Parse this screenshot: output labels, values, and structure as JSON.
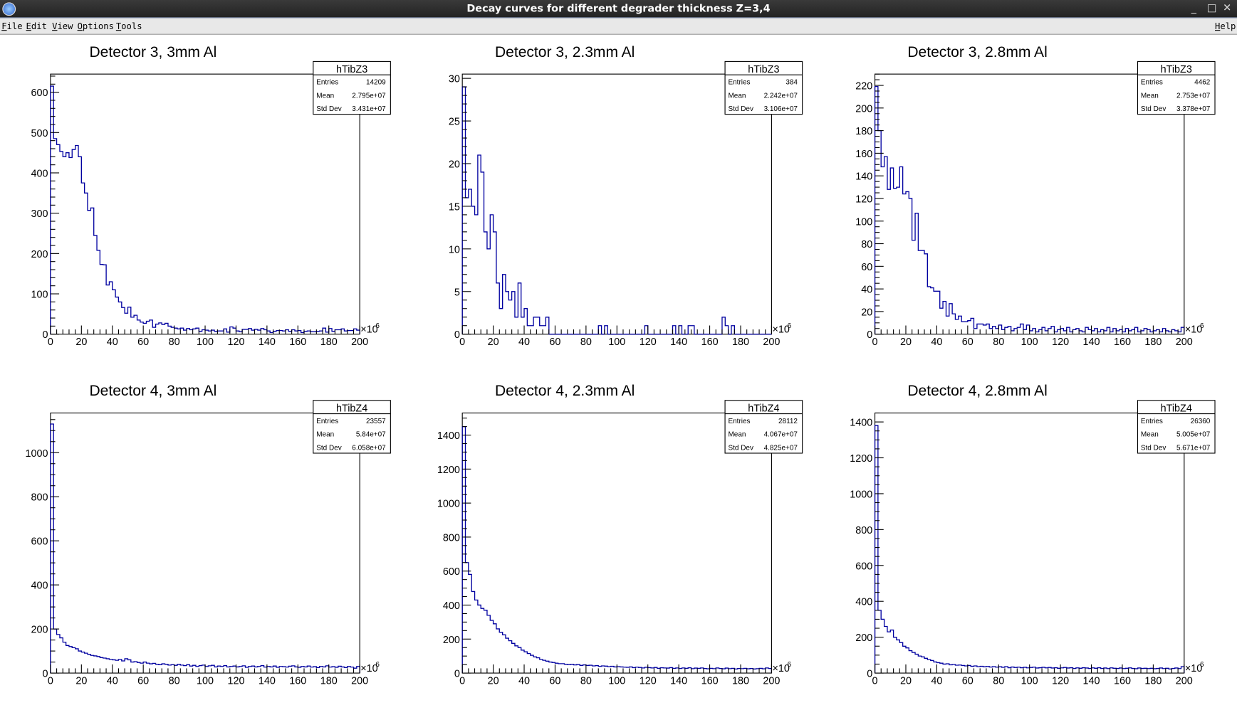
{
  "window": {
    "title": "Decay curves for different degrader thickness Z=3,4",
    "buttons": {
      "minimize": "_",
      "maximize": "□",
      "close": "✕"
    }
  },
  "menu": {
    "items": [
      "File",
      "Edit",
      "View",
      "Options",
      "Tools"
    ],
    "help": "Help"
  },
  "colors": {
    "line": "#0000a0",
    "frame": "#000000"
  },
  "chart_data": [
    {
      "type": "histogram",
      "title": "Detector 3, 3mm Al",
      "stats": {
        "name": "hTibZ3",
        "rows": [
          [
            "Entries",
            "14209"
          ],
          [
            "Mean",
            "2.795e+07"
          ],
          [
            "Std Dev",
            "3.431e+07"
          ]
        ]
      },
      "xlim": [
        0,
        200
      ],
      "x_multiplier": "×10",
      "x_exponent": "6",
      "xticks": [
        "0",
        "20",
        "40",
        "60",
        "80",
        "100",
        "120",
        "140",
        "160",
        "180",
        "200"
      ],
      "ylim": [
        0,
        645
      ],
      "yticks": [
        0,
        100,
        200,
        300,
        400,
        500,
        600
      ],
      "yminor": 20,
      "values": [
        615,
        485,
        470,
        453,
        440,
        450,
        438,
        458,
        468,
        440,
        375,
        350,
        307,
        313,
        245,
        208,
        173,
        172,
        122,
        130,
        110,
        92,
        80,
        66,
        52,
        67,
        42,
        47,
        35,
        30,
        27,
        32,
        35,
        17,
        25,
        28,
        24,
        27,
        20,
        17,
        15,
        13,
        15,
        10,
        14,
        11,
        13,
        15,
        7,
        11,
        10,
        8,
        10,
        7,
        8,
        8,
        13,
        5,
        18,
        15,
        8,
        6,
        12,
        12,
        14,
        10,
        12,
        10,
        14,
        11,
        8,
        4,
        7,
        9,
        9,
        8,
        11,
        7,
        11,
        8,
        9,
        4,
        7,
        8,
        6,
        6,
        7,
        8,
        15,
        5,
        14,
        7,
        11,
        11,
        13,
        8,
        9,
        9,
        13,
        10
      ]
    },
    {
      "type": "histogram",
      "title": "Detector 3, 2.3mm Al",
      "stats": {
        "name": "hTibZ3",
        "rows": [
          [
            "Entries",
            "384"
          ],
          [
            "Mean",
            "2.242e+07"
          ],
          [
            "Std Dev",
            "3.106e+07"
          ]
        ]
      },
      "xlim": [
        0,
        200
      ],
      "x_multiplier": "×10",
      "x_exponent": "6",
      "xticks": [
        "0",
        "20",
        "40",
        "60",
        "80",
        "100",
        "120",
        "140",
        "160",
        "180",
        "200"
      ],
      "ylim": [
        0,
        30.5
      ],
      "yticks": [
        0,
        5,
        10,
        15,
        20,
        25,
        30
      ],
      "yminor": 1,
      "values": [
        29,
        16,
        17,
        15,
        14,
        21,
        19,
        12,
        10,
        14,
        12,
        6,
        3,
        7,
        5,
        4,
        5,
        2,
        6,
        2,
        3,
        1,
        1,
        2,
        2,
        1,
        1,
        2,
        0,
        0,
        0,
        0,
        0,
        0,
        0,
        0,
        0,
        0,
        0,
        0,
        0,
        0,
        0,
        0,
        1,
        0,
        1,
        0,
        0,
        0,
        0,
        0,
        0,
        0,
        0,
        0,
        0,
        0,
        0,
        1,
        0,
        0,
        0,
        0,
        0,
        0,
        0,
        0,
        1,
        0,
        1,
        0,
        0,
        1,
        1,
        0,
        0,
        0,
        0,
        0,
        0,
        0,
        0,
        0,
        2,
        1,
        0,
        1,
        0,
        0,
        0,
        0,
        0,
        0,
        0,
        0,
        0,
        0,
        0,
        0
      ]
    },
    {
      "type": "histogram",
      "title": "Detector 3, 2.8mm Al",
      "stats": {
        "name": "hTibZ3",
        "rows": [
          [
            "Entries",
            "4462"
          ],
          [
            "Mean",
            "2.753e+07"
          ],
          [
            "Std Dev",
            "3.378e+07"
          ]
        ]
      },
      "xlim": [
        0,
        200
      ],
      "x_multiplier": "×10",
      "x_exponent": "6",
      "xticks": [
        "0",
        "20",
        "40",
        "60",
        "80",
        "100",
        "120",
        "140",
        "160",
        "180",
        "200"
      ],
      "ylim": [
        0,
        230
      ],
      "yticks": [
        0,
        20,
        40,
        60,
        80,
        100,
        120,
        140,
        160,
        180,
        200,
        220
      ],
      "yminor": 5,
      "values": [
        219,
        180,
        148,
        157,
        128,
        147,
        129,
        130,
        148,
        124,
        126,
        120,
        83,
        107,
        74,
        74,
        71,
        42,
        41,
        38,
        38,
        23,
        29,
        16,
        27,
        18,
        13,
        16,
        11,
        11,
        12,
        14,
        5,
        9,
        9,
        8,
        9,
        5,
        7,
        5,
        8,
        4,
        6,
        7,
        3,
        5,
        6,
        9,
        4,
        8,
        3,
        5,
        2,
        4,
        6,
        3,
        5,
        7,
        2,
        4,
        5,
        3,
        6,
        2,
        4,
        5,
        3,
        2,
        6,
        4,
        3,
        5,
        2,
        4,
        3,
        6,
        2,
        5,
        3,
        4,
        2,
        5,
        3,
        4,
        6,
        2,
        3,
        5,
        4,
        2,
        3,
        4,
        2,
        5,
        3,
        2,
        4,
        3,
        2,
        6
      ]
    },
    {
      "type": "histogram",
      "title": "Detector 4, 3mm Al",
      "stats": {
        "name": "hTibZ4",
        "rows": [
          [
            "Entries",
            "23557"
          ],
          [
            "Mean",
            "5.84e+07"
          ],
          [
            "Std Dev",
            "6.058e+07"
          ]
        ]
      },
      "xlim": [
        0,
        200
      ],
      "x_multiplier": "×10",
      "x_exponent": "6",
      "xticks": [
        "0",
        "20",
        "40",
        "60",
        "80",
        "100",
        "120",
        "140",
        "160",
        "180",
        "200"
      ],
      "ylim": [
        0,
        1180
      ],
      "yticks": [
        0,
        200,
        400,
        600,
        800,
        1000
      ],
      "yminor": 50,
      "values": [
        1130,
        200,
        175,
        160,
        140,
        125,
        120,
        115,
        110,
        100,
        95,
        90,
        85,
        80,
        78,
        75,
        70,
        68,
        65,
        62,
        60,
        58,
        62,
        55,
        65,
        60,
        50,
        52,
        48,
        45,
        50,
        45,
        42,
        44,
        40,
        38,
        42,
        40,
        36,
        38,
        35,
        40,
        36,
        34,
        38,
        32,
        35,
        30,
        34,
        36,
        30,
        33,
        35,
        28,
        32,
        30,
        34,
        28,
        30,
        32,
        28,
        30,
        33,
        26,
        30,
        32,
        28,
        30,
        34,
        27,
        30,
        28,
        32,
        26,
        30,
        29,
        27,
        31,
        33,
        28,
        26,
        30,
        28,
        32,
        27,
        29,
        25,
        30,
        28,
        33,
        27,
        29,
        26,
        31,
        28,
        25,
        30,
        27,
        22,
        30
      ]
    },
    {
      "type": "histogram",
      "title": "Detector 4, 2.3mm Al",
      "stats": {
        "name": "hTibZ4",
        "rows": [
          [
            "Entries",
            "28112"
          ],
          [
            "Mean",
            "4.067e+07"
          ],
          [
            "Std Dev",
            "4.825e+07"
          ]
        ]
      },
      "xlim": [
        0,
        200
      ],
      "x_multiplier": "×10",
      "x_exponent": "6",
      "xticks": [
        "0",
        "20",
        "40",
        "60",
        "80",
        "100",
        "120",
        "140",
        "160",
        "180",
        "200"
      ],
      "ylim": [
        0,
        1530
      ],
      "yticks": [
        0,
        200,
        400,
        600,
        800,
        1000,
        1200,
        1400
      ],
      "yminor": 50,
      "values": [
        1450,
        650,
        580,
        480,
        430,
        400,
        380,
        370,
        340,
        310,
        290,
        260,
        240,
        225,
        205,
        190,
        175,
        160,
        150,
        135,
        125,
        115,
        105,
        95,
        90,
        80,
        75,
        70,
        65,
        62,
        58,
        55,
        55,
        52,
        50,
        52,
        48,
        50,
        45,
        48,
        45,
        46,
        42,
        44,
        40,
        42,
        41,
        38,
        40,
        36,
        38,
        36,
        35,
        34,
        36,
        32,
        35,
        33,
        30,
        34,
        32,
        30,
        33,
        28,
        31,
        30,
        29,
        32,
        28,
        30,
        27,
        30,
        28,
        31,
        26,
        29,
        28,
        30,
        27,
        25,
        28,
        26,
        30,
        27,
        25,
        29,
        26,
        28,
        24,
        27,
        26,
        28,
        25,
        27,
        24,
        26,
        28,
        25,
        30,
        27
      ]
    },
    {
      "type": "histogram",
      "title": "Detector 4, 2.8mm Al",
      "stats": {
        "name": "hTibZ4",
        "rows": [
          [
            "Entries",
            "26360"
          ],
          [
            "Mean",
            "5.005e+07"
          ],
          [
            "Std Dev",
            "5.671e+07"
          ]
        ]
      },
      "xlim": [
        0,
        200
      ],
      "x_multiplier": "×10",
      "x_exponent": "6",
      "xticks": [
        "0",
        "20",
        "40",
        "60",
        "80",
        "100",
        "120",
        "140",
        "160",
        "180",
        "200"
      ],
      "ylim": [
        0,
        1450
      ],
      "yticks": [
        0,
        200,
        400,
        600,
        800,
        1000,
        1200,
        1400
      ],
      "yminor": 50,
      "values": [
        1380,
        350,
        300,
        260,
        230,
        240,
        200,
        185,
        170,
        150,
        140,
        125,
        115,
        105,
        95,
        90,
        82,
        75,
        70,
        62,
        58,
        55,
        50,
        52,
        46,
        48,
        44,
        45,
        42,
        40,
        42,
        38,
        40,
        36,
        38,
        35,
        37,
        34,
        36,
        33,
        35,
        32,
        36,
        30,
        34,
        31,
        33,
        30,
        32,
        29,
        31,
        33,
        28,
        30,
        32,
        29,
        31,
        28,
        30,
        27,
        29,
        31,
        28,
        30,
        26,
        29,
        27,
        30,
        28,
        26,
        29,
        27,
        30,
        26,
        28,
        25,
        29,
        27,
        26,
        28,
        25,
        27,
        29,
        26,
        24,
        28,
        26,
        27,
        25,
        27,
        24,
        26,
        28,
        25,
        27,
        23,
        26,
        28,
        25,
        36
      ]
    }
  ]
}
